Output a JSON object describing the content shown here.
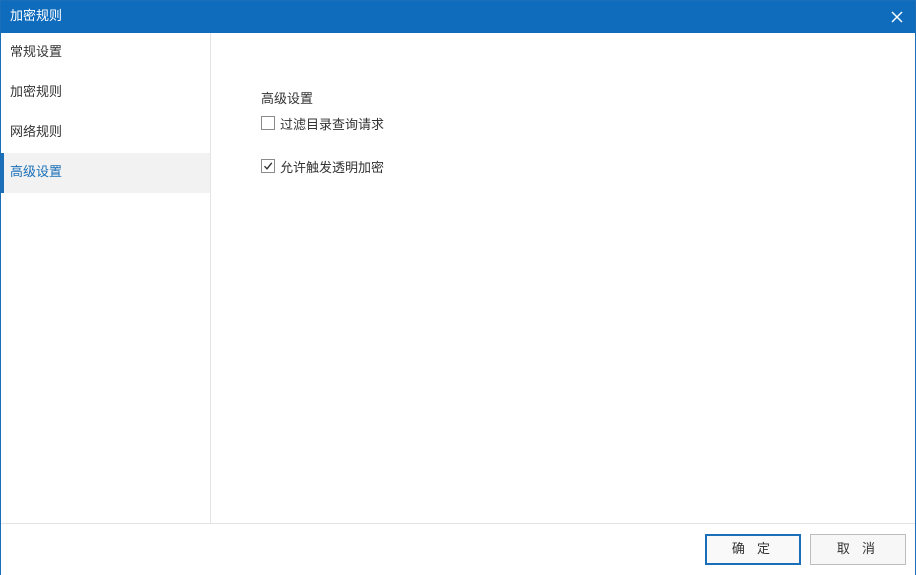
{
  "window": {
    "title": "加密规则"
  },
  "sidebar": {
    "items": [
      {
        "label": "常规设置",
        "active": false
      },
      {
        "label": "加密规则",
        "active": false
      },
      {
        "label": "网络规则",
        "active": false
      },
      {
        "label": "高级设置",
        "active": true
      }
    ]
  },
  "content": {
    "section_title": "高级设置",
    "options": [
      {
        "label": "过滤目录查询请求",
        "checked": false
      },
      {
        "label": "允许触发透明加密",
        "checked": true
      }
    ]
  },
  "footer": {
    "ok_label": "确 定",
    "cancel_label": "取 消"
  },
  "colors": {
    "titlebar": "#0f6cbd",
    "accent": "#1a6fb8"
  },
  "icons": {
    "close": "close-icon",
    "check": "checkmark-icon"
  }
}
